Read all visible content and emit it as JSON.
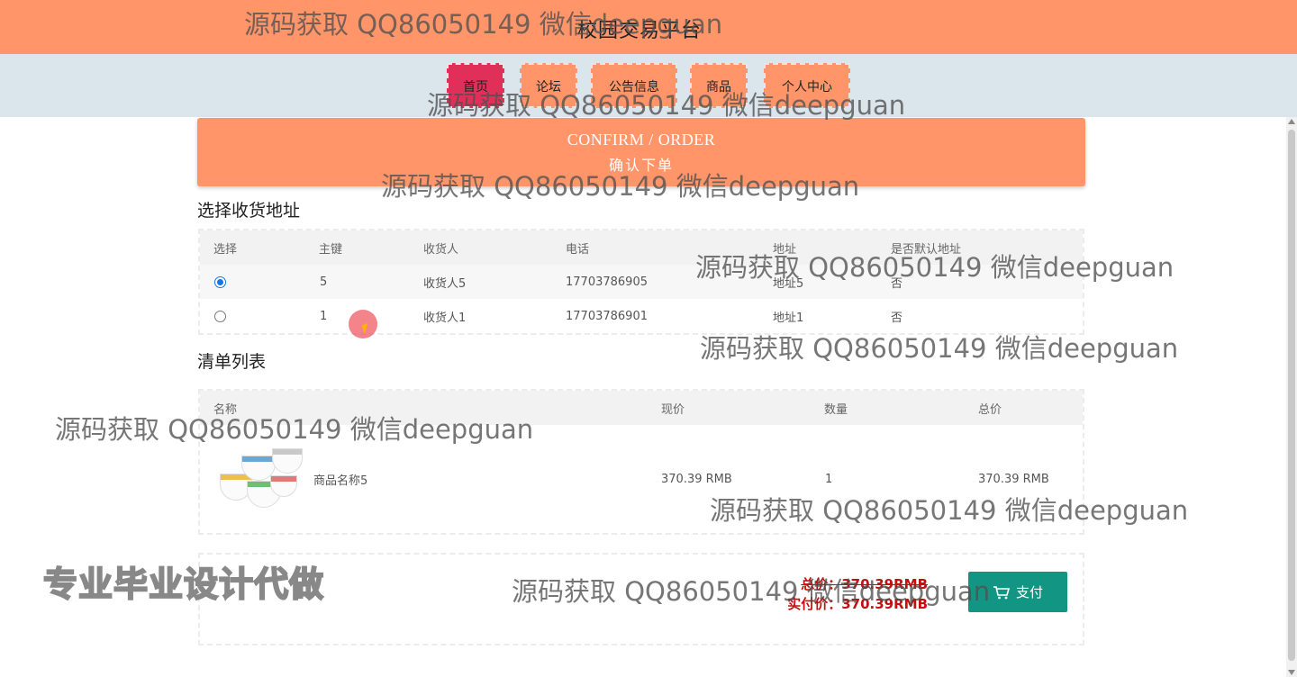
{
  "header": {
    "title": "校园交易平台"
  },
  "nav": {
    "items": [
      {
        "label": "首页",
        "active": true
      },
      {
        "label": "论坛",
        "active": false
      },
      {
        "label": "公告信息",
        "active": false
      },
      {
        "label": "商品",
        "active": false
      },
      {
        "label": "个人中心",
        "active": false
      }
    ]
  },
  "banner": {
    "title_en": "CONFIRM / ORDER",
    "title_cn": "确认下单"
  },
  "address_section": {
    "title": "选择收货地址",
    "columns": [
      "选择",
      "主键",
      "收货人",
      "电话",
      "地址",
      "是否默认地址"
    ],
    "rows": [
      {
        "selected": true,
        "id": "5",
        "receiver": "收货人5",
        "phone": "17703786905",
        "address": "地址5",
        "is_default": "否"
      },
      {
        "selected": false,
        "id": "1",
        "receiver": "收货人1",
        "phone": "17703786901",
        "address": "地址1",
        "is_default": "否"
      }
    ]
  },
  "list_section": {
    "title": "清单列表",
    "columns": [
      "名称",
      "现价",
      "数量",
      "总价"
    ],
    "rows": [
      {
        "name": "商品名称5",
        "price": "370.39 RMB",
        "quantity": "1",
        "total": "370.39 RMB"
      }
    ]
  },
  "payment": {
    "total_label": "总价：370.39RMB",
    "actual_label": "实付价：370.39RMB",
    "pay_button": "支付",
    "pay_color": "#129683"
  },
  "watermarks": [
    "源码获取 QQ86050149 微信deepguan",
    "源码获取 QQ86050149 微信deepguan",
    "源码获取 QQ86050149 微信deepguan",
    "源码获取 QQ86050149 微信deepguan",
    "源码获取 QQ86050149 微信deepguan",
    "源码获取 QQ86050149 微信deepguan",
    "源码获取 QQ86050149 微信deepguan",
    "源码获取 QQ86050149 微信deepguan"
  ],
  "promo_text": "专业毕业设计代做",
  "colors": {
    "header": "#ff9569",
    "nav_bg": "#dbe5ec",
    "nav_active": "#e0305a"
  }
}
